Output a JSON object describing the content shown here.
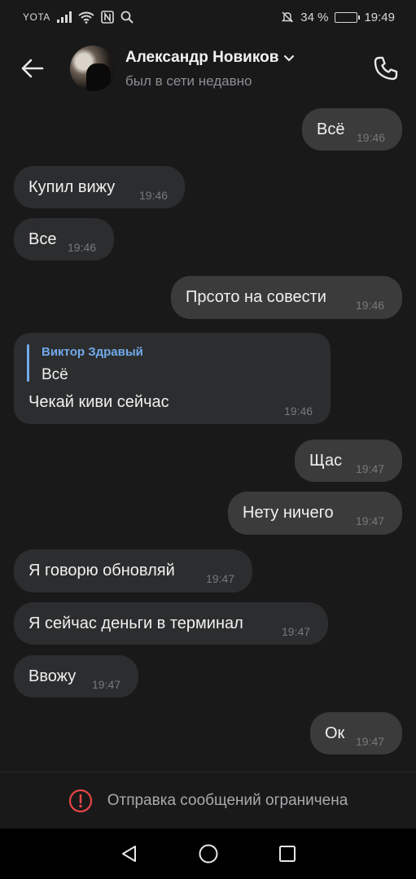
{
  "status_bar": {
    "carrier": "YOTA",
    "battery": "34 %",
    "battery_level": 0.34,
    "time": "19:49"
  },
  "header": {
    "contact_name": "Александр Новиков",
    "contact_status": "был в сети недавно"
  },
  "messages": [
    {
      "dir": "out",
      "text": "Всё",
      "time": "19:46"
    },
    {
      "dir": "in",
      "text": "Купил вижу",
      "time": "19:46"
    },
    {
      "dir": "in",
      "text": "Все",
      "time": "19:46"
    },
    {
      "dir": "out",
      "text": "Прсото на совести",
      "time": "19:46"
    },
    {
      "dir": "in",
      "reply_author": "Виктор Здравый",
      "reply_text": "Всё",
      "text": "Чекай киви сейчас",
      "time": "19:46"
    },
    {
      "dir": "out",
      "text": "Щас",
      "time": "19:47"
    },
    {
      "dir": "out",
      "text": "Нету ничего",
      "time": "19:47"
    },
    {
      "dir": "in",
      "text": "Я говорю обновляй",
      "time": "19:47"
    },
    {
      "dir": "in",
      "text": "Я сейчас деньги в терминал",
      "time": "19:47"
    },
    {
      "dir": "in",
      "text": "Ввожу",
      "time": "19:47"
    },
    {
      "dir": "out",
      "text": "Ок",
      "time": "19:47"
    }
  ],
  "restriction": {
    "text": "Отправка сообщений ограничена",
    "icon": "alert-circle-icon",
    "icon_color": "#e64646"
  },
  "icons": {
    "back": "arrow-left-icon",
    "call": "phone-icon",
    "nav": [
      "back-triangle-icon",
      "home-circle-icon",
      "recents-square-icon"
    ]
  }
}
